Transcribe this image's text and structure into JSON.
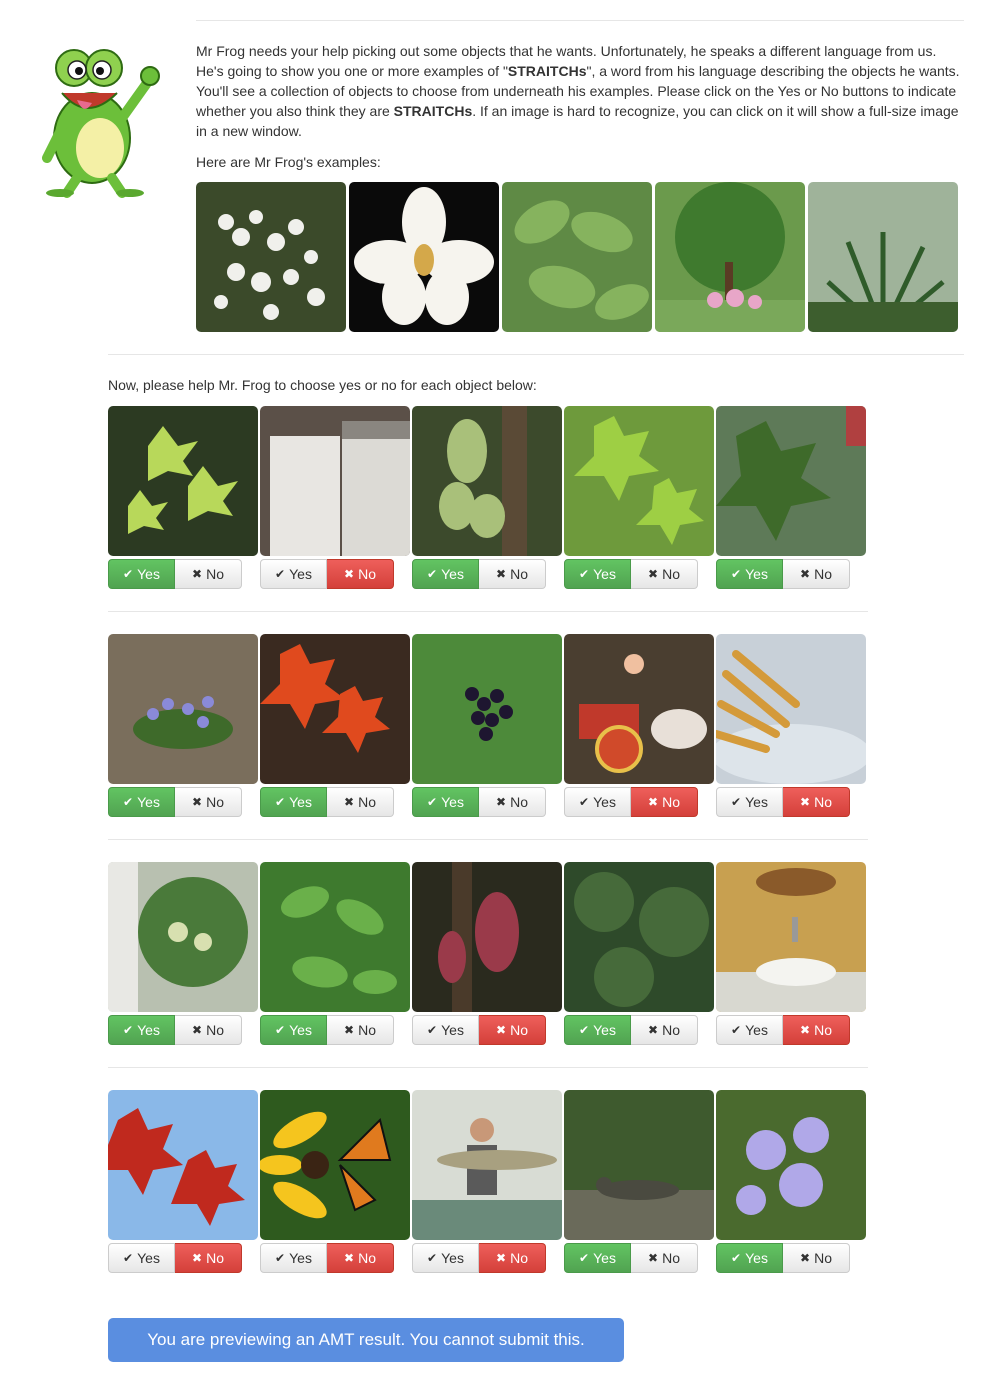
{
  "intro": {
    "before_word": "Mr Frog needs your help picking out some objects that he wants. Unfortunately, he speaks a different language from us. He's going to show you one or more examples of \"",
    "word": "STRAITCHs",
    "middle": "\", a word from his language describing the objects he wants. You'll see a collection of objects to choose from underneath his examples. Please click on the Yes or No buttons to indicate whether you also think they are ",
    "word2": "STRAITCHs",
    "after": ". If an image is hard to recognize, you can click on it will show a full-size image in a new window."
  },
  "examples_title": "Here are Mr Frog's examples:",
  "example_icons": [
    "white-berries-image",
    "magnolia-flower-image",
    "green-leaves-image",
    "tree-garden-image",
    "tropical-plants-image"
  ],
  "prompt": "Now, please help Mr. Frog to choose yes or no for each object below:",
  "buttons": {
    "yes": "Yes",
    "no": "No"
  },
  "items": [
    {
      "image": "maple-sapling-image",
      "selected": "yes"
    },
    {
      "image": "washing-machine-image",
      "selected": "no"
    },
    {
      "image": "cacao-pods-image",
      "selected": "yes"
    },
    {
      "image": "green-maple-leaves-image",
      "selected": "yes"
    },
    {
      "image": "maple-tree-image",
      "selected": "yes"
    },
    {
      "image": "purple-flowers-image",
      "selected": "yes"
    },
    {
      "image": "red-maple-image",
      "selected": "yes"
    },
    {
      "image": "elderberries-image",
      "selected": "yes"
    },
    {
      "image": "ox-cart-image",
      "selected": "no"
    },
    {
      "image": "french-fries-image",
      "selected": "no"
    },
    {
      "image": "elder-tree-image",
      "selected": "yes"
    },
    {
      "image": "leafy-branch-image",
      "selected": "yes"
    },
    {
      "image": "red-cacao-pods-image",
      "selected": "no"
    },
    {
      "image": "dark-foliage-image",
      "selected": "yes"
    },
    {
      "image": "sink-basin-image",
      "selected": "no"
    },
    {
      "image": "autumn-maple-image",
      "selected": "no"
    },
    {
      "image": "butterfly-flower-image",
      "selected": "no"
    },
    {
      "image": "fisherman-image",
      "selected": "no"
    },
    {
      "image": "iguana-image",
      "selected": "yes"
    },
    {
      "image": "blue-mistflower-image",
      "selected": "yes"
    }
  ],
  "submit_notice": "You are previewing an AMT result. You cannot submit this.",
  "colors": {
    "yes_active": "#5cb85c",
    "no_active": "#d9534f",
    "notice": "#5a8ee0"
  }
}
